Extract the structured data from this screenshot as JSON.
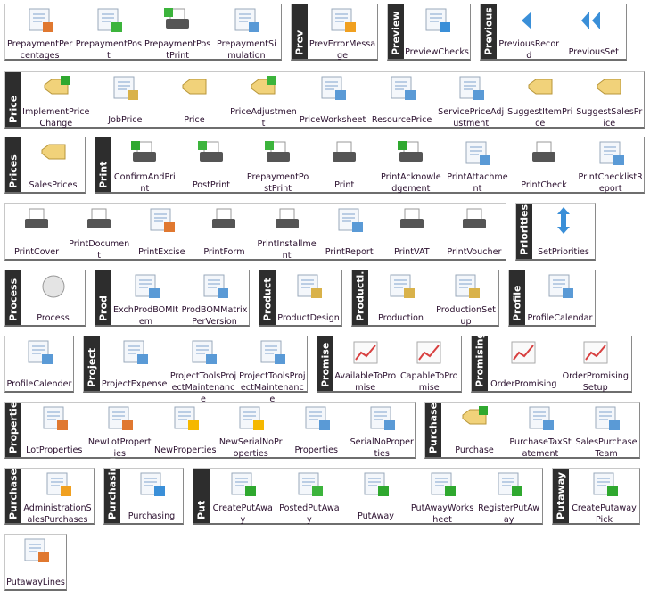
{
  "colors": {
    "label_bg": "#2d2d2d",
    "label_text": "#ffffff",
    "item_text": "#2a0f2e"
  },
  "rows": [
    [
      {
        "label": "",
        "items": [
          {
            "name": "PrepaymentPercentages",
            "icon": "percent-doc-icon"
          },
          {
            "name": "PrepaymentPost",
            "icon": "post-add-icon"
          },
          {
            "name": "PrepaymentPostPrint",
            "icon": "post-print-icon"
          },
          {
            "name": "PrepaymentSimulation",
            "icon": "simulation-icon"
          }
        ]
      },
      {
        "label": "Prev",
        "items": [
          {
            "name": "PrevErrorMessage",
            "icon": "warning-doc-icon"
          }
        ]
      },
      {
        "label": "Preview",
        "items": [
          {
            "name": "PreviewChecks",
            "icon": "magnifier-icon"
          }
        ]
      },
      {
        "label": "Previous",
        "items": [
          {
            "name": "PreviousRecord",
            "icon": "arrow-left-icon"
          },
          {
            "name": "PreviousSet",
            "icon": "double-arrow-left-icon"
          }
        ]
      }
    ],
    [
      {
        "label": "Price",
        "items": [
          {
            "name": "ImplementPriceChange",
            "icon": "price-tag-check-icon"
          },
          {
            "name": "JobPrice",
            "icon": "job-price-icon"
          },
          {
            "name": "Price",
            "icon": "price-tag-icon"
          },
          {
            "name": "PriceAdjustment",
            "icon": "price-tag-adjust-icon"
          },
          {
            "name": "PriceWorksheet",
            "icon": "worksheet-icon"
          },
          {
            "name": "ResourcePrice",
            "icon": "forklift-icon"
          },
          {
            "name": "ServicePriceAdjustment",
            "icon": "tools-icon"
          },
          {
            "name": "SuggestItemPrice",
            "icon": "box-icon"
          },
          {
            "name": "SuggestSalesPrice",
            "icon": "sales-price-icon"
          }
        ]
      }
    ],
    [
      {
        "label": "Prices",
        "items": [
          {
            "name": "SalesPrices",
            "icon": "price-tag-icon"
          }
        ]
      },
      {
        "label": "Print",
        "items": [
          {
            "name": "ConfirmAndPrint",
            "icon": "printer-check-icon"
          },
          {
            "name": "PostPrint",
            "icon": "printer-add-icon"
          },
          {
            "name": "PrepaymentPostPrint",
            "icon": "post-print-icon"
          },
          {
            "name": "Print",
            "icon": "printer-icon"
          },
          {
            "name": "PrintAcknowledgement",
            "icon": "printer-check-icon"
          },
          {
            "name": "PrintAttachment",
            "icon": "paperclip-icon"
          },
          {
            "name": "PrintCheck",
            "icon": "printer-icon"
          },
          {
            "name": "PrintChecklistReport",
            "icon": "report-icon"
          }
        ]
      }
    ],
    [
      {
        "label": "",
        "items": [
          {
            "name": "PrintCover",
            "icon": "printer-icon"
          },
          {
            "name": "PrintDocument",
            "icon": "printer-icon"
          },
          {
            "name": "PrintExcise",
            "icon": "percent-doc-icon"
          },
          {
            "name": "PrintForm",
            "icon": "printer-icon"
          },
          {
            "name": "PrintInstallment",
            "icon": "printer-icon"
          },
          {
            "name": "PrintReport",
            "icon": "report-icon"
          },
          {
            "name": "PrintVAT",
            "icon": "printer-icon"
          },
          {
            "name": "PrintVoucher",
            "icon": "printer-icon"
          }
        ]
      },
      {
        "label": "Priorities",
        "items": [
          {
            "name": "SetPriorities",
            "icon": "up-down-arrow-icon"
          }
        ]
      }
    ],
    [
      {
        "label": "Process",
        "items": [
          {
            "name": "Process",
            "icon": "circle-icon"
          }
        ]
      },
      {
        "label": "Prod",
        "items": [
          {
            "name": "ExchProdBOMItem",
            "icon": "bom-tree-icon"
          },
          {
            "name": "ProdBOMMatrixPerVersion",
            "icon": "matrix-icon"
          }
        ]
      },
      {
        "label": "Product",
        "items": [
          {
            "name": "ProductDesign",
            "icon": "design-icon"
          }
        ]
      },
      {
        "label": "Producti...",
        "items": [
          {
            "name": "Production",
            "icon": "conveyor-icon"
          },
          {
            "name": "ProductionSetup",
            "icon": "conveyor-gear-icon"
          }
        ]
      },
      {
        "label": "Profile",
        "items": [
          {
            "name": "ProfileCalendar",
            "icon": "calendar-user-icon"
          }
        ]
      }
    ],
    [
      {
        "label": "",
        "items": [
          {
            "name": "ProfileCalender",
            "icon": "calendar-user-icon"
          }
        ]
      },
      {
        "label": "Project",
        "items": [
          {
            "name": "ProjectExpense",
            "icon": "expense-icon"
          },
          {
            "name": "ProjectToolsProjectMaintenance",
            "icon": "project-tools-icon"
          },
          {
            "name": "ProjectToolsProjectMaintenance",
            "icon": "project-tools-icon"
          }
        ]
      },
      {
        "label": "Promise",
        "items": [
          {
            "name": "AvailableToPromise",
            "icon": "chart-icon"
          },
          {
            "name": "CapableToPromise",
            "icon": "chart-bar-icon"
          }
        ]
      },
      {
        "label": "Promising",
        "items": [
          {
            "name": "OrderPromising",
            "icon": "chart-question-icon"
          },
          {
            "name": "OrderPromisingSetup",
            "icon": "chart-gear-icon"
          }
        ]
      }
    ],
    [
      {
        "label": "Properties",
        "items": [
          {
            "name": "LotProperties",
            "icon": "form-grid-icon"
          },
          {
            "name": "NewLotProperties",
            "icon": "new-form-grid-icon"
          },
          {
            "name": "NewProperties",
            "icon": "new-form-icon"
          },
          {
            "name": "NewSerialNoProperties",
            "icon": "new-form-abc-icon"
          },
          {
            "name": "Properties",
            "icon": "form-icon"
          },
          {
            "name": "SerialNoProperties",
            "icon": "form-abc-icon"
          }
        ]
      },
      {
        "label": "Purchase",
        "items": [
          {
            "name": "Purchase",
            "icon": "checklist-box-icon"
          },
          {
            "name": "PurchaseTaxStatement",
            "icon": "tax-statement-icon"
          },
          {
            "name": "SalesPurchaseTeam",
            "icon": "team-icon"
          }
        ]
      }
    ],
    [
      {
        "label": "Purchases",
        "items": [
          {
            "name": "AdministrationSalesPurchases",
            "icon": "admin-icon"
          }
        ]
      },
      {
        "label": "Purchasing",
        "items": [
          {
            "name": "Purchasing",
            "icon": "purchasing-icon"
          }
        ]
      },
      {
        "label": "Put",
        "items": [
          {
            "name": "CreatePutAway",
            "icon": "checklist-icon"
          },
          {
            "name": "PostedPutAway",
            "icon": "checklist-add-icon"
          },
          {
            "name": "PutAway",
            "icon": "checklist-icon"
          },
          {
            "name": "PutAwayWorksheet",
            "icon": "checklist-icon"
          },
          {
            "name": "RegisterPutAway",
            "icon": "checklist-check-icon"
          }
        ]
      },
      {
        "label": "Putaway",
        "items": [
          {
            "name": "CreatePutawayPick",
            "icon": "checklist-icon"
          }
        ]
      }
    ],
    [
      {
        "label": "",
        "items": [
          {
            "name": "PutawayLines",
            "icon": "grid-lines-icon"
          }
        ]
      }
    ]
  ]
}
